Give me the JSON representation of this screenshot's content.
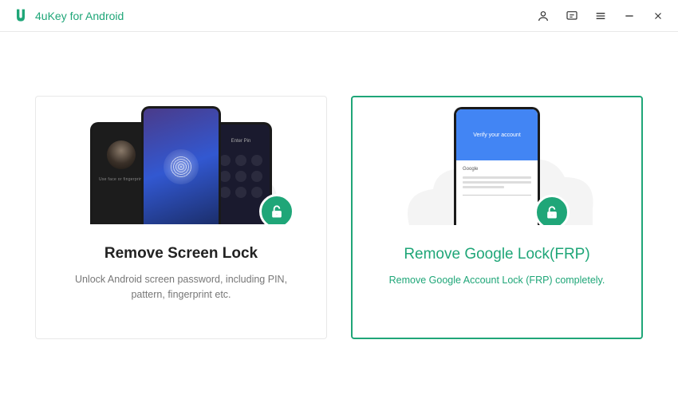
{
  "app": {
    "title": "4uKey for Android"
  },
  "titlebar_icons": {
    "user": "user-icon",
    "feedback": "feedback-icon",
    "menu": "menu-icon",
    "minimize": "minimize-icon",
    "close": "close-icon"
  },
  "cards": {
    "screen_lock": {
      "title": "Remove Screen Lock",
      "description": "Unlock Android screen password, including PIN, pattern, fingerprint etc.",
      "selected": false
    },
    "google_lock": {
      "title": "Remove Google Lock(FRP)",
      "description": "Remove Google Account Lock (FRP) completely.",
      "selected": true,
      "google_header": "Verify your account",
      "google_logo": "Google"
    }
  },
  "colors": {
    "accent": "#1fa678",
    "google_blue": "#4285f4"
  }
}
